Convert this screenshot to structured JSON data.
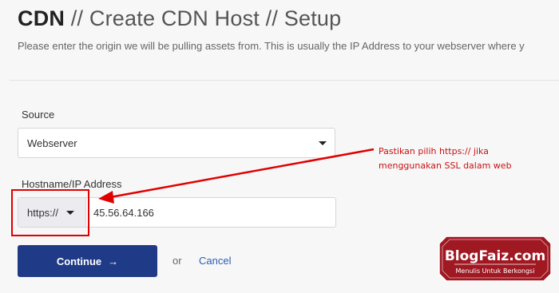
{
  "header": {
    "brand": "CDN",
    "crumbs": " // Create CDN Host // Setup",
    "subtitle": "Please enter the origin we will be pulling assets from. This is usually the IP Address to your webserver where y"
  },
  "form": {
    "source_label": "Source",
    "source_value": "Webserver",
    "hostname_label": "Hostname/IP Address",
    "protocol_value": "https://",
    "hostname_value": "45.56.64.166"
  },
  "actions": {
    "continue_label": "Continue",
    "continue_arrow": "→",
    "or_text": "or",
    "cancel_label": "Cancel"
  },
  "annotation": {
    "line1": "Pastikan pilih https:// jika",
    "line2": "menggunakan SSL dalam web",
    "color": "#cc1111"
  },
  "watermark": {
    "name": "BlogFaiz.com",
    "tagline": "Menulis Untuk Berkongsi",
    "color": "#a01822"
  },
  "colors": {
    "primary_button": "#1f3a86",
    "link": "#2a5db0",
    "highlight": "#e00000"
  }
}
